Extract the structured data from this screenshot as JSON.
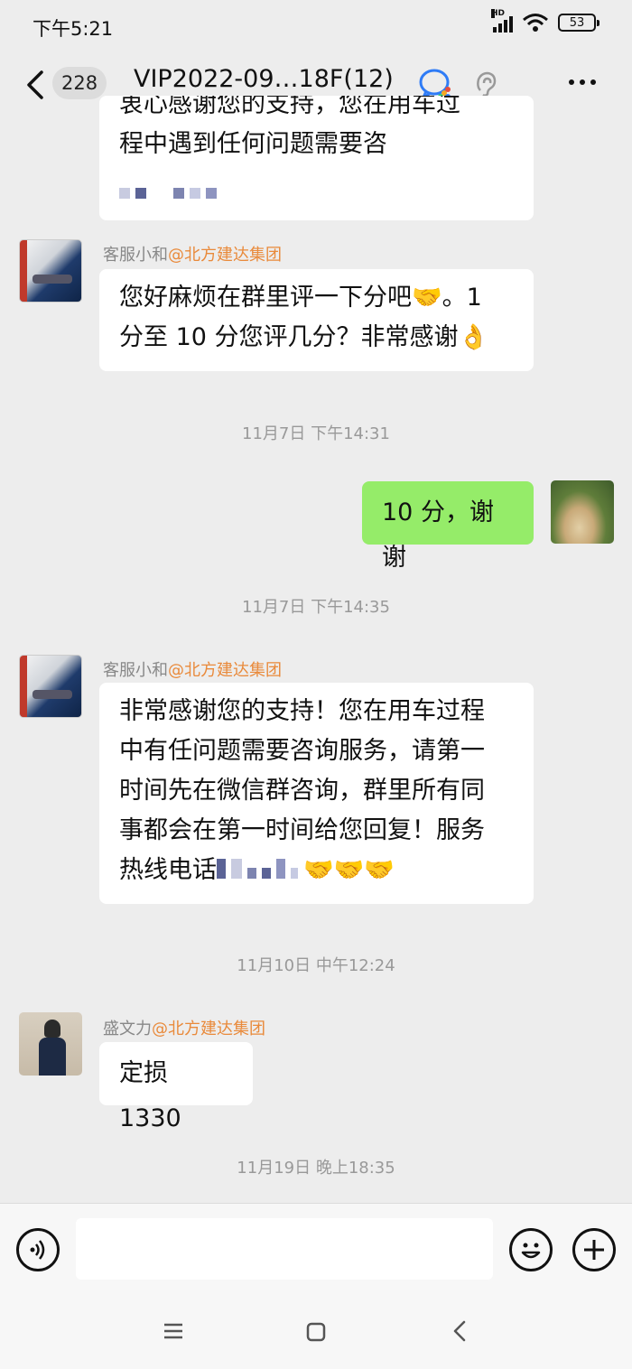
{
  "status_bar": {
    "time": "下午5:21",
    "network": "HD",
    "battery": "53"
  },
  "header": {
    "unread_count": "228",
    "title": "VIP2022-09…18F(12)"
  },
  "messages": {
    "partial_top": {
      "line1": "衷心感谢您的支持，您在用车过",
      "line2": "程中遇到任何问题需要咨"
    },
    "msg1": {
      "sender_name": "客服小和",
      "sender_org": "@北方建达集团",
      "line1": "您好麻烦在群里评一下分吧🤝。1",
      "line2": "分至 10 分您评几分？非常感谢👌"
    },
    "ts1": "11月7日 下午14:31",
    "msg2": {
      "text": "10 分，谢谢"
    },
    "ts2": "11月7日 下午14:35",
    "msg3": {
      "sender_name": "客服小和",
      "sender_org": "@北方建达集团",
      "line1": "非常感谢您的支持！您在用车过程",
      "line2": "中有任问题需要咨询服务，请第一",
      "line3": "时间先在微信群咨询，群里所有同",
      "line4": "事都会在第一时间给您回复！服务",
      "line5_prefix": "热线电话",
      "line5_suffix": "🤝🤝🤝"
    },
    "ts3": "11月10日 中午12:24",
    "msg4": {
      "sender_name": "盛文力",
      "sender_org": "@北方建达集团",
      "text": "定损 1330"
    },
    "ts4": "11月19日 晚上18:35"
  },
  "colors": {
    "background": "#ededed",
    "my_bubble": "#95ec69",
    "other_bubble": "#ffffff",
    "org_highlight": "#e98a3b"
  }
}
